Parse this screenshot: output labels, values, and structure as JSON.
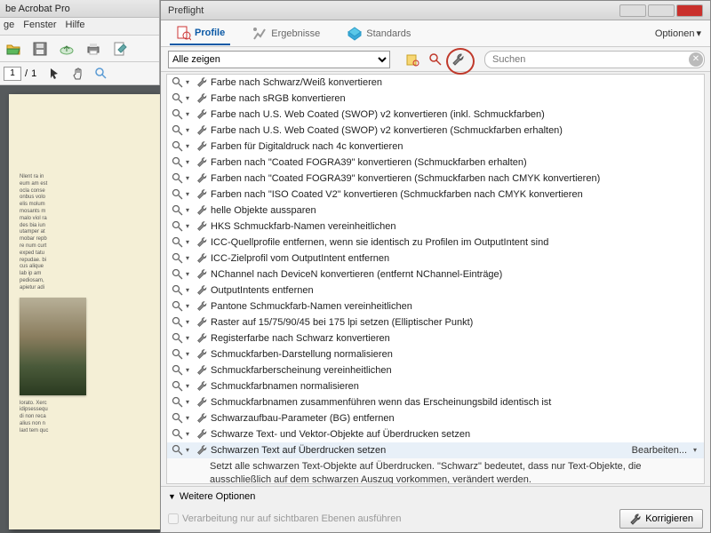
{
  "main": {
    "title": "be Acrobat Pro",
    "menu": [
      "ge",
      "Fenster",
      "Hilfe"
    ],
    "page_current": "1",
    "page_total": "1",
    "doc_text_top": "Nlent ra in\neum am est\nocla conse\nonbus volo\nelis molum\nmosants m\nmalo viol ra\ndes bia iun\nutamper at\nmobar repb\nre num curt\nexped tatu\nrepudae. bi\ncus alique\nlab ip am\npediosam,\napietur adi",
    "doc_text_bottom": "lorato. Xerc\nidipsessequ\ndi non reca\nalius non n\nlaxt tem quc"
  },
  "preflight": {
    "title": "Preflight",
    "tabs": {
      "profile": "Profile",
      "ergebnisse": "Ergebnisse",
      "standards": "Standards"
    },
    "options": "Optionen",
    "filter_selected": "Alle zeigen",
    "search_placeholder": "Suchen",
    "items": [
      "Farbe nach Schwarz/Weiß konvertieren",
      "Farbe nach sRGB konvertieren",
      "Farbe nach U.S. Web Coated (SWOP) v2 konvertieren (inkl. Schmuckfarben)",
      "Farbe nach U.S. Web Coated (SWOP) v2 konvertieren (Schmuckfarben erhalten)",
      "Farben für Digitaldruck nach 4c konvertieren",
      "Farben nach \"Coated FOGRA39\" konvertieren (Schmuckfarben erhalten)",
      "Farben nach \"Coated FOGRA39\" konvertieren (Schmuckfarben nach CMYK konvertieren)",
      "Farben nach \"ISO Coated V2\" konvertieren (Schmuckfarben nach CMYK konvertieren",
      "helle Objekte aussparen",
      "HKS Schmuckfarb-Namen vereinheitlichen",
      "ICC-Quellprofile entfernen, wenn sie identisch zu Profilen im OutputIntent sind",
      "ICC-Zielprofil vom OutputIntent entfernen",
      "NChannel nach DeviceN konvertieren (entfernt NChannel-Einträge)",
      "OutputIntents entfernen",
      "Pantone Schmuckfarb-Namen vereinheitlichen",
      "Raster auf 15/75/90/45 bei 175 lpi setzen (Elliptischer Punkt)",
      "Registerfarbe nach Schwarz konvertieren",
      "Schmuckfarben-Darstellung normalisieren",
      "Schmuckfarberscheinung vereinheitlichen",
      "Schmuckfarbnamen normalisieren",
      "Schmuckfarbnamen zusammenführen wenn das Erscheinungsbild identisch ist",
      "Schwarzaufbau-Parameter (BG) entfernen",
      "Schwarze Text- und Vektor-Objekte auf Überdrucken setzen",
      "Schwarzen Text auf Überdrucken setzen"
    ],
    "selected_index": 23,
    "edit_label": "Bearbeiten...",
    "selected_desc": "Setzt alle schwarzen Text-Objekte auf Überdrucken. \"Schwarz\" bedeutet, dass nur Text-Objekte, die ausschließlich auf dem schwarzen Auszug vorkommen, verändert werden.",
    "more_options": "Weitere Optionen",
    "checkbox_label": "Verarbeitung nur auf sichtbaren Ebenen ausführen",
    "fix_button": "Korrigieren"
  }
}
